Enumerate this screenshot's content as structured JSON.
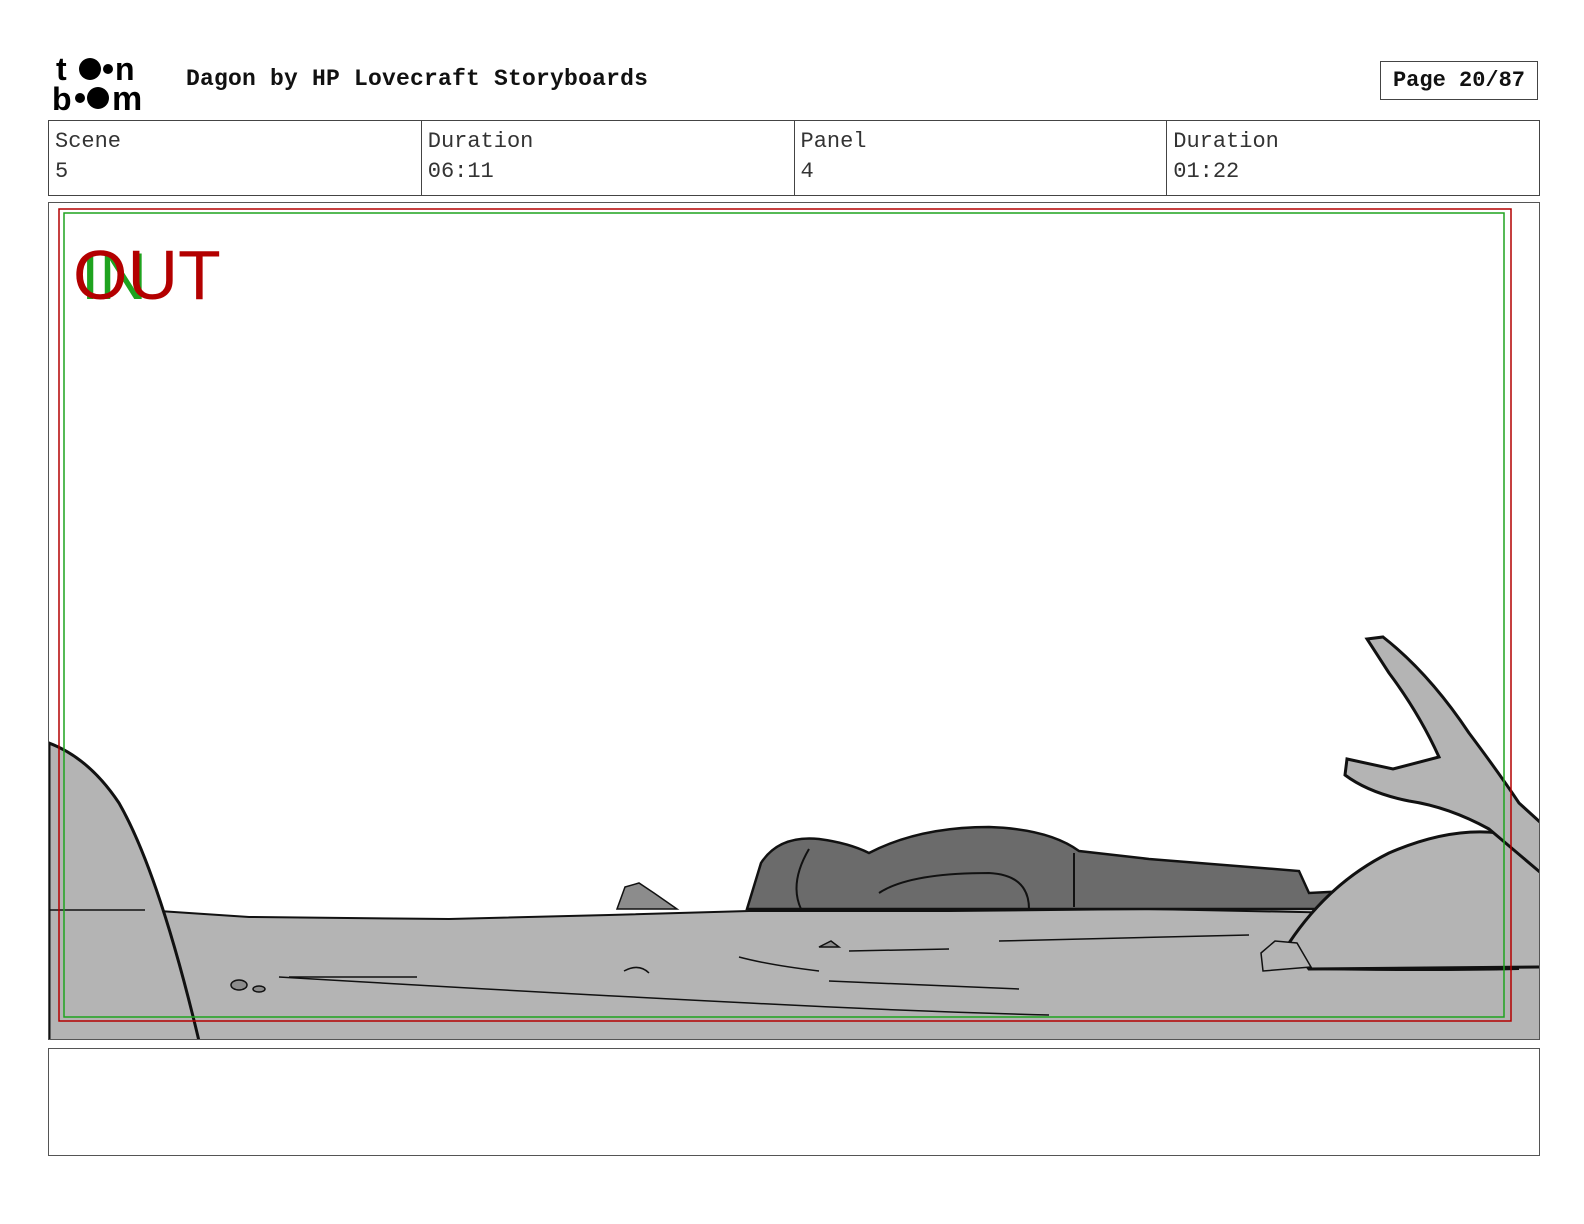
{
  "header": {
    "logo_text": "toon boom",
    "title": "Dagon by HP Lovecraft Storyboards",
    "page_label": "Page 20/87"
  },
  "info": [
    {
      "label": "Scene",
      "value": "5"
    },
    {
      "label": "Duration",
      "value": "06:11"
    },
    {
      "label": "Panel",
      "value": "4"
    },
    {
      "label": "Duration",
      "value": "01:22"
    }
  ],
  "panel": {
    "safe_labels": {
      "out": "OUT",
      "in": "IN"
    },
    "colors": {
      "out": "#b30000",
      "in": "#1fa31f",
      "ground": "#b4b4b4",
      "figure": "#6b6b6b"
    }
  },
  "caption": {
    "text": ""
  }
}
